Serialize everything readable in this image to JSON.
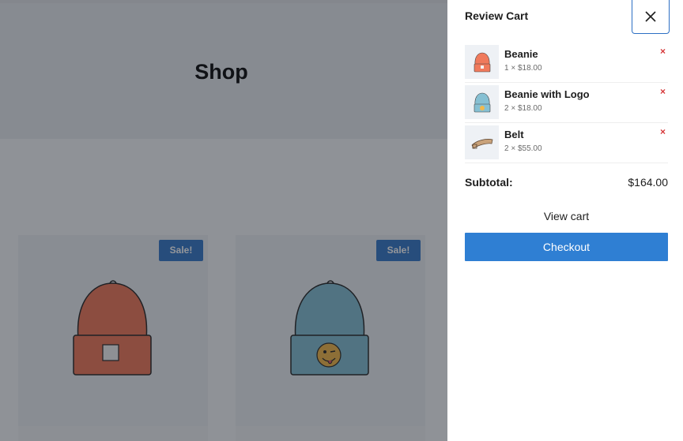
{
  "shop": {
    "title": "Shop",
    "products": [
      {
        "badge": "Sale!",
        "icon": "beanie-orange-icon"
      },
      {
        "badge": "Sale!",
        "icon": "beanie-with-logo-icon"
      }
    ]
  },
  "cart": {
    "title": "Review Cart",
    "close_icon": "close-icon",
    "items": [
      {
        "name": "Beanie",
        "qty": "1 × $18.00",
        "remove": "×",
        "icon": "beanie-icon"
      },
      {
        "name": "Beanie with Logo",
        "qty": "2 × $18.00",
        "remove": "×",
        "icon": "beanie-with-logo-icon"
      },
      {
        "name": "Belt",
        "qty": "2 × $55.00",
        "remove": "×",
        "icon": "belt-icon"
      }
    ],
    "subtotal_label": "Subtotal:",
    "subtotal_value": "$164.00",
    "view_cart_label": "View cart",
    "checkout_label": "Checkout"
  },
  "colors": {
    "accent": "#2f7fd3",
    "sale_badge": "#3a7bc8",
    "remove": "#d63638"
  }
}
